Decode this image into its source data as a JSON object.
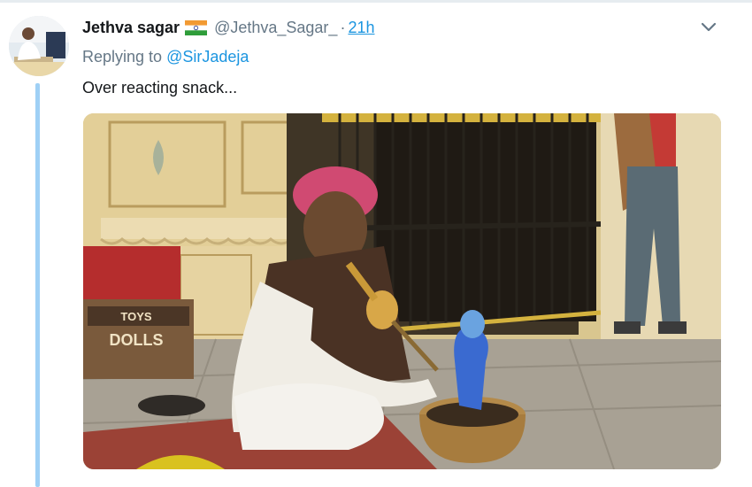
{
  "tweet": {
    "display_name": "Jethva sagar",
    "flag_icon": "india-flag-icon",
    "handle": "@Jethva_Sagar_",
    "separator": "·",
    "timestamp": "21h",
    "replying_prefix": "Replying to",
    "replying_to": "@SirJadeja",
    "text": "Over reacting snack...",
    "more_icon": "chevron-down-icon"
  },
  "media": {
    "box_brand": "TOYS",
    "box_label_line1": "TOYS",
    "box_label_line2": "DOLLS",
    "box_label_line3": "DOLLS"
  },
  "colors": {
    "link": "#1b95e0",
    "secondary_text": "#657786",
    "primary_text": "#14171a",
    "thread_line": "#9fd0f5"
  }
}
